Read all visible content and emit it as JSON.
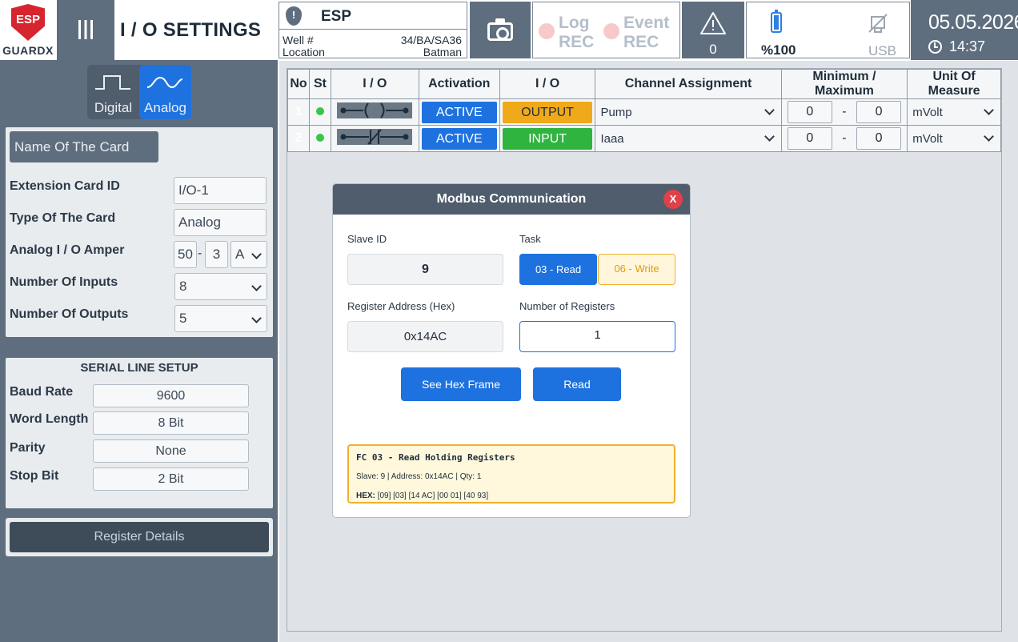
{
  "brand": {
    "badge": "ESP",
    "name": "GUARDX"
  },
  "header": {
    "menu_icon": "menu-icon",
    "title": "I / O SETTINGS",
    "esp": {
      "name": "ESP",
      "well_label": "Well #",
      "well_value": "34/BA/SA36",
      "location_label": "Location",
      "location_value": "Batman"
    },
    "log_rec": {
      "line1": "Log",
      "line2": "REC"
    },
    "event_rec": {
      "line1": "Event",
      "line2": "REC"
    },
    "alarm_count": "0",
    "battery": "%100",
    "usb": "USB",
    "date": "05.05.2026",
    "time": "14:37"
  },
  "left": {
    "mode_tabs": [
      {
        "label": "Digital"
      },
      {
        "label": "Analog",
        "active": true
      }
    ],
    "card_name_placeholder": "Name Of The Card",
    "fields": {
      "ext_id_label": "Extension Card ID",
      "ext_id_value": "I/O-1",
      "type_label": "Type Of The Card",
      "type_value": "Analog",
      "amper_label": "Analog I / O Amper",
      "amper_a": "50",
      "amper_sep": "-",
      "amper_b": "3",
      "amper_unit": "A",
      "inputs_label": "Number Of Inputs",
      "inputs_value": "8",
      "outputs_label": "Number Of Outputs",
      "outputs_value": "5"
    },
    "serial": {
      "title": "SERIAL LINE SETUP",
      "baud_label": "Baud Rate",
      "baud_value": "9600",
      "word_label": "Word Length",
      "word_value": "8 Bit",
      "parity_label": "Parity",
      "parity_value": "None",
      "stop_label": "Stop Bit",
      "stop_value": "2 Bit"
    },
    "register_details": "Register Details"
  },
  "table": {
    "headers": [
      "No",
      "St",
      "I / O",
      "Activation",
      "I / O",
      "Channel Assignment",
      "Minimum / Maximum",
      "Unit Of Measure"
    ],
    "rows": [
      {
        "no": "1",
        "activation": "ACTIVE",
        "io": "OUTPUT",
        "channel": "Pump",
        "min": "0",
        "sep": "-",
        "max": "0",
        "unit": "mVolt"
      },
      {
        "no": "2",
        "activation": "ACTIVE",
        "io": "INPUT",
        "channel": "Iaaa",
        "min": "0",
        "sep": "-",
        "max": "0",
        "unit": "mVolt"
      }
    ]
  },
  "modal": {
    "title": "Modbus Communication",
    "close": "X",
    "slave_label": "Slave ID",
    "slave_value": "9",
    "task_label": "Task",
    "task_read": "03 - Read",
    "task_write": "06 - Write",
    "register_label": "Register Address (Hex)",
    "register_value": "0x14AC",
    "count_label": "Number of Registers",
    "count_value": "1",
    "see_hex_button": "See Hex Frame",
    "read_button": "Read",
    "frame_title": "FC 03 - Read Holding Registers",
    "frame_info": "Slave: 9 | Address: 0x14AC | Qty: 1",
    "frame_hex_label": "HEX:",
    "frame_hex_value": "[09] [03] [14 AC] [00 01] [40 93]"
  },
  "colors": {
    "accent": "#1e72e0",
    "panel": "#5f6e7e",
    "active_green": "#2fb43f",
    "output_orange": "#f0a91a",
    "close_red": "#e0404a"
  }
}
